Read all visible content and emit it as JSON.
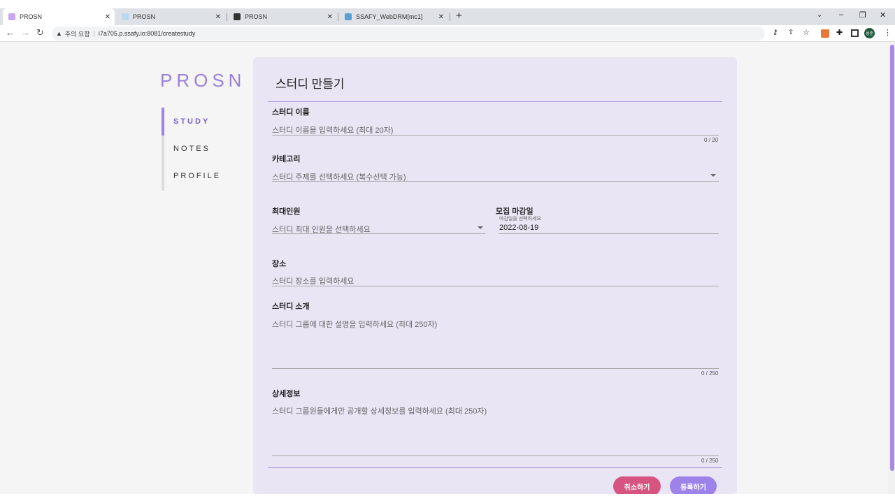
{
  "browser": {
    "tabs": [
      {
        "title": "PROSN",
        "active": true
      },
      {
        "title": "PROSN"
      },
      {
        "title": "PROSN"
      },
      {
        "title": "SSAFY_WebDRM[mc1]"
      }
    ],
    "new_tab": "+",
    "security": "주의 요함",
    "url": "i7a705.p.ssafy.io:8081/createstudy",
    "profile": "성준"
  },
  "sidebar": {
    "logo": "PROSN",
    "items": [
      {
        "label": "STUDY",
        "active": true
      },
      {
        "label": "NOTES"
      },
      {
        "label": "PROFILE"
      }
    ]
  },
  "form": {
    "title": "스터디 만들기",
    "name": {
      "label": "스터디 이름",
      "placeholder": "스터디 이름을 입력하세요 (최대 20자)",
      "counter": "0 / 20"
    },
    "category": {
      "label": "카테고리",
      "placeholder": "스터디 주제를 선택하세요 (복수선택 가능)"
    },
    "max": {
      "label": "최대인원",
      "placeholder": "스터디 최대 인원을 선택하세요"
    },
    "deadline": {
      "label": "모집 마감일",
      "hint": "마감일을 선택하세요",
      "value": "2022-08-19"
    },
    "place": {
      "label": "장소",
      "placeholder": "스터디 장소를 입력하세요"
    },
    "intro": {
      "label": "스터디 소개",
      "placeholder": "스터디 그룹에 대한 설명을 입력하세요 (최대 250자)",
      "counter": "0 / 250"
    },
    "detail": {
      "label": "상세정보",
      "placeholder": "스터디 그룹원들에게만 공개할 상세정보를 입력하세요 (최대 250자)",
      "counter": "0 / 250"
    },
    "cancel": "취소하기",
    "submit": "등록하기",
    "colors": {
      "cancel": "#d6547f",
      "submit": "#9d82ea",
      "accent": "#8a6fd6"
    }
  }
}
